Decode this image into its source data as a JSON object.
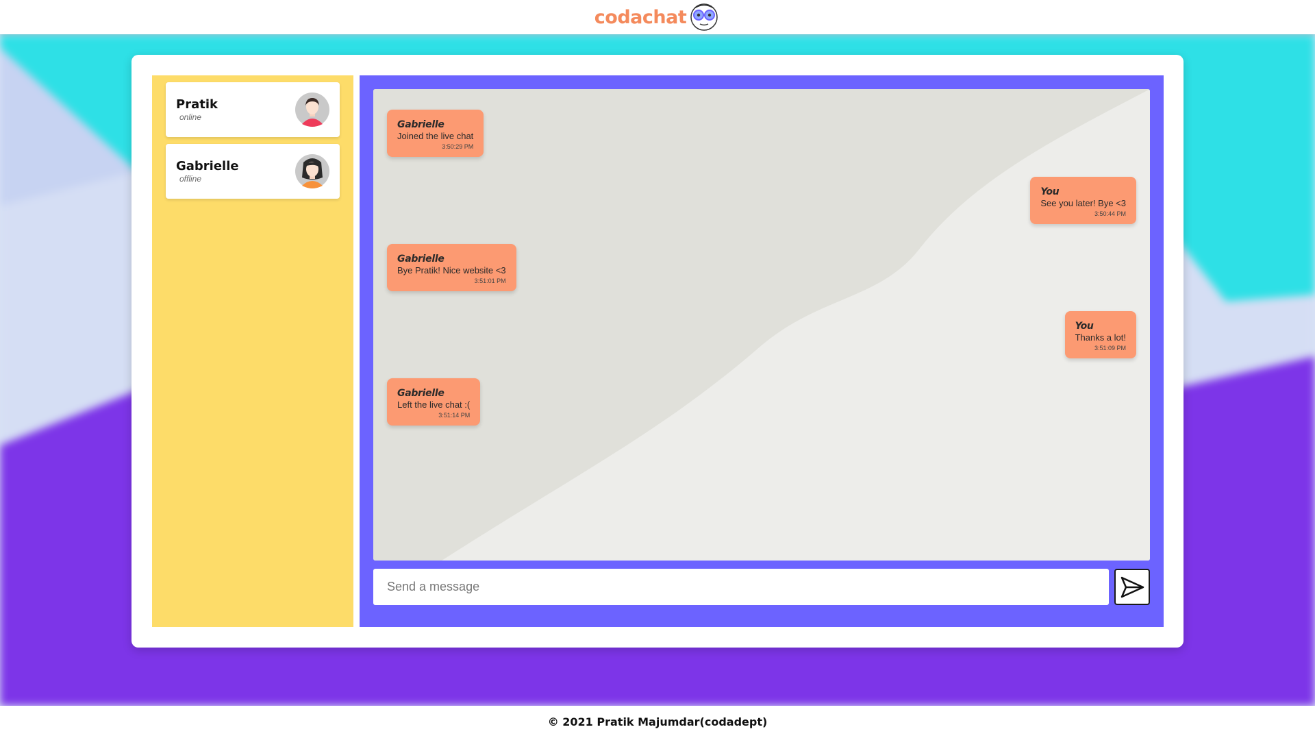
{
  "header": {
    "logo_text": "codachat",
    "logo_icon": "glasses-face-icon"
  },
  "colors": {
    "logo_text": "#f48a5c",
    "sidebar": "#fddc69",
    "chat_panel": "#6c63ff",
    "message_bubble": "#fc9a72",
    "bg_cyan": "#2ee0e6",
    "bg_purple": "#7d35e8"
  },
  "sidebar": {
    "users": [
      {
        "name": "Pratik",
        "status": "online",
        "avatar": "male-avatar-icon"
      },
      {
        "name": "Gabrielle",
        "status": "offline",
        "avatar": "female-avatar-icon"
      }
    ]
  },
  "chat": {
    "messages": [
      {
        "author": "Gabrielle",
        "text": "Joined the live chat",
        "time": "3:50:29 PM",
        "side": "left"
      },
      {
        "author": "You",
        "text": "See you later! Bye <3",
        "time": "3:50:44 PM",
        "side": "right"
      },
      {
        "author": "Gabrielle",
        "text": "Bye Pratik! Nice website <3",
        "time": "3:51:01 PM",
        "side": "left"
      },
      {
        "author": "You",
        "text": "Thanks a lot!",
        "time": "3:51:09 PM",
        "side": "right"
      },
      {
        "author": "Gabrielle",
        "text": "Left the live chat :(",
        "time": "3:51:14 PM",
        "side": "left"
      }
    ],
    "input_placeholder": "Send a message",
    "send_icon": "send-icon"
  },
  "footer": {
    "text": "© 2021 Pratik Majumdar(codadept)"
  }
}
